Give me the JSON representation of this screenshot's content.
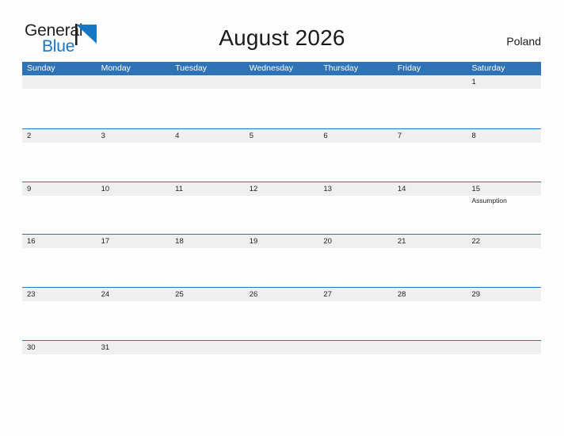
{
  "brand": {
    "name_part1": "General",
    "name_part2": "Blue",
    "flag_icon": "triangle-flag-icon",
    "accent_color": "#1877c4"
  },
  "header": {
    "title": "August 2026",
    "country": "Poland"
  },
  "colors": {
    "header_blue": "#2e72b8",
    "row_band_gray": "#efefef",
    "page_background": "#fdfdfd",
    "text": "#222222"
  },
  "calendar": {
    "month": "August",
    "year": "2026",
    "weekday_headers": [
      "Sunday",
      "Monday",
      "Tuesday",
      "Wednesday",
      "Thursday",
      "Friday",
      "Saturday"
    ],
    "weeks": [
      [
        {
          "day": "",
          "event": ""
        },
        {
          "day": "",
          "event": ""
        },
        {
          "day": "",
          "event": ""
        },
        {
          "day": "",
          "event": ""
        },
        {
          "day": "",
          "event": ""
        },
        {
          "day": "",
          "event": ""
        },
        {
          "day": "1",
          "event": ""
        }
      ],
      [
        {
          "day": "2",
          "event": ""
        },
        {
          "day": "3",
          "event": ""
        },
        {
          "day": "4",
          "event": ""
        },
        {
          "day": "5",
          "event": ""
        },
        {
          "day": "6",
          "event": ""
        },
        {
          "day": "7",
          "event": ""
        },
        {
          "day": "8",
          "event": ""
        }
      ],
      [
        {
          "day": "9",
          "event": ""
        },
        {
          "day": "10",
          "event": ""
        },
        {
          "day": "11",
          "event": ""
        },
        {
          "day": "12",
          "event": ""
        },
        {
          "day": "13",
          "event": ""
        },
        {
          "day": "14",
          "event": ""
        },
        {
          "day": "15",
          "event": "Assumption"
        }
      ],
      [
        {
          "day": "16",
          "event": ""
        },
        {
          "day": "17",
          "event": ""
        },
        {
          "day": "18",
          "event": ""
        },
        {
          "day": "19",
          "event": ""
        },
        {
          "day": "20",
          "event": ""
        },
        {
          "day": "21",
          "event": ""
        },
        {
          "day": "22",
          "event": ""
        }
      ],
      [
        {
          "day": "23",
          "event": ""
        },
        {
          "day": "24",
          "event": ""
        },
        {
          "day": "25",
          "event": ""
        },
        {
          "day": "26",
          "event": ""
        },
        {
          "day": "27",
          "event": ""
        },
        {
          "day": "28",
          "event": ""
        },
        {
          "day": "29",
          "event": ""
        }
      ],
      [
        {
          "day": "30",
          "event": ""
        },
        {
          "day": "31",
          "event": ""
        },
        {
          "day": "",
          "event": ""
        },
        {
          "day": "",
          "event": ""
        },
        {
          "day": "",
          "event": ""
        },
        {
          "day": "",
          "event": ""
        },
        {
          "day": "",
          "event": ""
        }
      ]
    ]
  }
}
